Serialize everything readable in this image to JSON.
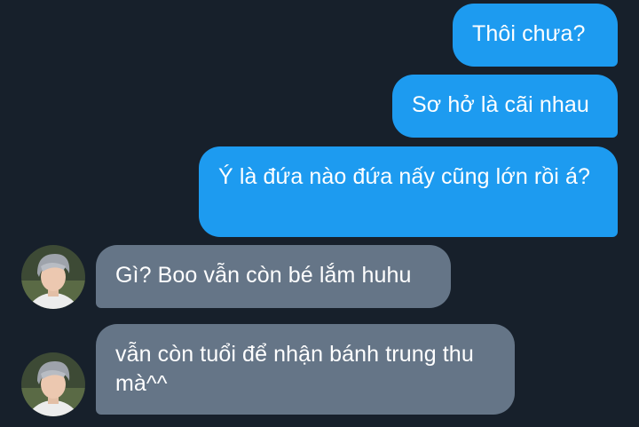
{
  "conversation": {
    "messages": [
      {
        "direction": "sent",
        "text": "Thôi chưa?"
      },
      {
        "direction": "sent",
        "text": "Sơ hở là cãi nhau"
      },
      {
        "direction": "sent",
        "text": "Ý là đứa nào đứa nấy cũng lớn rồi á?"
      },
      {
        "direction": "received",
        "text": "Gì? Boo vẫn còn bé lắm huhu"
      },
      {
        "direction": "received",
        "text": "vẫn còn tuổi để nhận bánh trung thu mà^^"
      }
    ]
  },
  "colors": {
    "background": "#17202b",
    "sent_bubble": "#1d9bf0",
    "received_bubble": "#657587",
    "text": "#ffffff"
  },
  "icons": {
    "avatar": "user-avatar-photo"
  }
}
